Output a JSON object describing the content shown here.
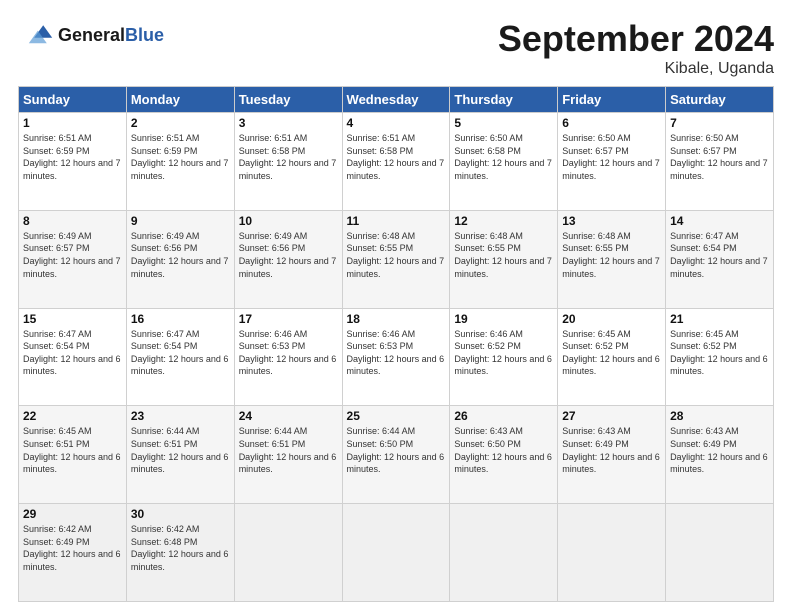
{
  "header": {
    "logo_line1": "General",
    "logo_line2": "Blue",
    "month_title": "September 2024",
    "location": "Kibale, Uganda"
  },
  "weekdays": [
    "Sunday",
    "Monday",
    "Tuesday",
    "Wednesday",
    "Thursday",
    "Friday",
    "Saturday"
  ],
  "weeks": [
    [
      {
        "day": "1",
        "sunrise": "6:51 AM",
        "sunset": "6:59 PM",
        "daylight": "12 hours and 7 minutes."
      },
      {
        "day": "2",
        "sunrise": "6:51 AM",
        "sunset": "6:59 PM",
        "daylight": "12 hours and 7 minutes."
      },
      {
        "day": "3",
        "sunrise": "6:51 AM",
        "sunset": "6:58 PM",
        "daylight": "12 hours and 7 minutes."
      },
      {
        "day": "4",
        "sunrise": "6:51 AM",
        "sunset": "6:58 PM",
        "daylight": "12 hours and 7 minutes."
      },
      {
        "day": "5",
        "sunrise": "6:50 AM",
        "sunset": "6:58 PM",
        "daylight": "12 hours and 7 minutes."
      },
      {
        "day": "6",
        "sunrise": "6:50 AM",
        "sunset": "6:57 PM",
        "daylight": "12 hours and 7 minutes."
      },
      {
        "day": "7",
        "sunrise": "6:50 AM",
        "sunset": "6:57 PM",
        "daylight": "12 hours and 7 minutes."
      }
    ],
    [
      {
        "day": "8",
        "sunrise": "6:49 AM",
        "sunset": "6:57 PM",
        "daylight": "12 hours and 7 minutes."
      },
      {
        "day": "9",
        "sunrise": "6:49 AM",
        "sunset": "6:56 PM",
        "daylight": "12 hours and 7 minutes."
      },
      {
        "day": "10",
        "sunrise": "6:49 AM",
        "sunset": "6:56 PM",
        "daylight": "12 hours and 7 minutes."
      },
      {
        "day": "11",
        "sunrise": "6:48 AM",
        "sunset": "6:55 PM",
        "daylight": "12 hours and 7 minutes."
      },
      {
        "day": "12",
        "sunrise": "6:48 AM",
        "sunset": "6:55 PM",
        "daylight": "12 hours and 7 minutes."
      },
      {
        "day": "13",
        "sunrise": "6:48 AM",
        "sunset": "6:55 PM",
        "daylight": "12 hours and 7 minutes."
      },
      {
        "day": "14",
        "sunrise": "6:47 AM",
        "sunset": "6:54 PM",
        "daylight": "12 hours and 7 minutes."
      }
    ],
    [
      {
        "day": "15",
        "sunrise": "6:47 AM",
        "sunset": "6:54 PM",
        "daylight": "12 hours and 6 minutes."
      },
      {
        "day": "16",
        "sunrise": "6:47 AM",
        "sunset": "6:54 PM",
        "daylight": "12 hours and 6 minutes."
      },
      {
        "day": "17",
        "sunrise": "6:46 AM",
        "sunset": "6:53 PM",
        "daylight": "12 hours and 6 minutes."
      },
      {
        "day": "18",
        "sunrise": "6:46 AM",
        "sunset": "6:53 PM",
        "daylight": "12 hours and 6 minutes."
      },
      {
        "day": "19",
        "sunrise": "6:46 AM",
        "sunset": "6:52 PM",
        "daylight": "12 hours and 6 minutes."
      },
      {
        "day": "20",
        "sunrise": "6:45 AM",
        "sunset": "6:52 PM",
        "daylight": "12 hours and 6 minutes."
      },
      {
        "day": "21",
        "sunrise": "6:45 AM",
        "sunset": "6:52 PM",
        "daylight": "12 hours and 6 minutes."
      }
    ],
    [
      {
        "day": "22",
        "sunrise": "6:45 AM",
        "sunset": "6:51 PM",
        "daylight": "12 hours and 6 minutes."
      },
      {
        "day": "23",
        "sunrise": "6:44 AM",
        "sunset": "6:51 PM",
        "daylight": "12 hours and 6 minutes."
      },
      {
        "day": "24",
        "sunrise": "6:44 AM",
        "sunset": "6:51 PM",
        "daylight": "12 hours and 6 minutes."
      },
      {
        "day": "25",
        "sunrise": "6:44 AM",
        "sunset": "6:50 PM",
        "daylight": "12 hours and 6 minutes."
      },
      {
        "day": "26",
        "sunrise": "6:43 AM",
        "sunset": "6:50 PM",
        "daylight": "12 hours and 6 minutes."
      },
      {
        "day": "27",
        "sunrise": "6:43 AM",
        "sunset": "6:49 PM",
        "daylight": "12 hours and 6 minutes."
      },
      {
        "day": "28",
        "sunrise": "6:43 AM",
        "sunset": "6:49 PM",
        "daylight": "12 hours and 6 minutes."
      }
    ],
    [
      {
        "day": "29",
        "sunrise": "6:42 AM",
        "sunset": "6:49 PM",
        "daylight": "12 hours and 6 minutes."
      },
      {
        "day": "30",
        "sunrise": "6:42 AM",
        "sunset": "6:48 PM",
        "daylight": "12 hours and 6 minutes."
      },
      null,
      null,
      null,
      null,
      null
    ]
  ]
}
